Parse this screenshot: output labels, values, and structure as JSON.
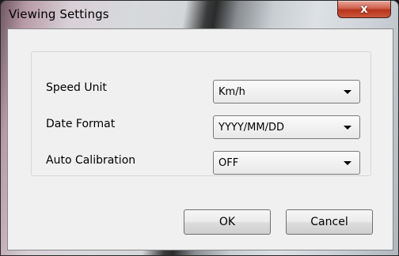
{
  "window": {
    "title": "Viewing Settings",
    "close_glyph": "x"
  },
  "settings": [
    {
      "label": "Speed Unit",
      "value": "Km/h"
    },
    {
      "label": "Date Format",
      "value": "YYYY/MM/DD"
    },
    {
      "label": "Auto Calibration",
      "value": "OFF"
    }
  ],
  "buttons": {
    "ok_label": "OK",
    "cancel_label": "Cancel"
  },
  "icons": {
    "close": "close-icon",
    "dropdown": "chevron-down-icon"
  },
  "colors": {
    "close_button": "#c9573a",
    "dialog_background": "#f0f0f0"
  }
}
